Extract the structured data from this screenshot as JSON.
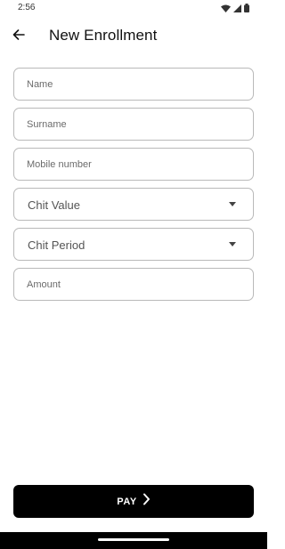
{
  "status_bar": {
    "time": "2:56",
    "icons": [
      "wifi-icon",
      "signal-icon",
      "battery-icon"
    ]
  },
  "app_bar": {
    "title": "New Enrollment",
    "back_icon": "arrow-left-icon"
  },
  "form": {
    "name_placeholder": "Name",
    "surname_placeholder": "Surname",
    "mobile_placeholder": "Mobile number",
    "chit_value_label": "Chit Value",
    "chit_period_label": "Chit Period",
    "amount_placeholder": "Amount"
  },
  "pay_button": {
    "label": "PAY",
    "icon": "chevron-right-icon"
  },
  "colors": {
    "field_border": "#b9b9b9",
    "button_bg": "#000000",
    "button_text": "#ffffff",
    "background": "#ffffff"
  }
}
